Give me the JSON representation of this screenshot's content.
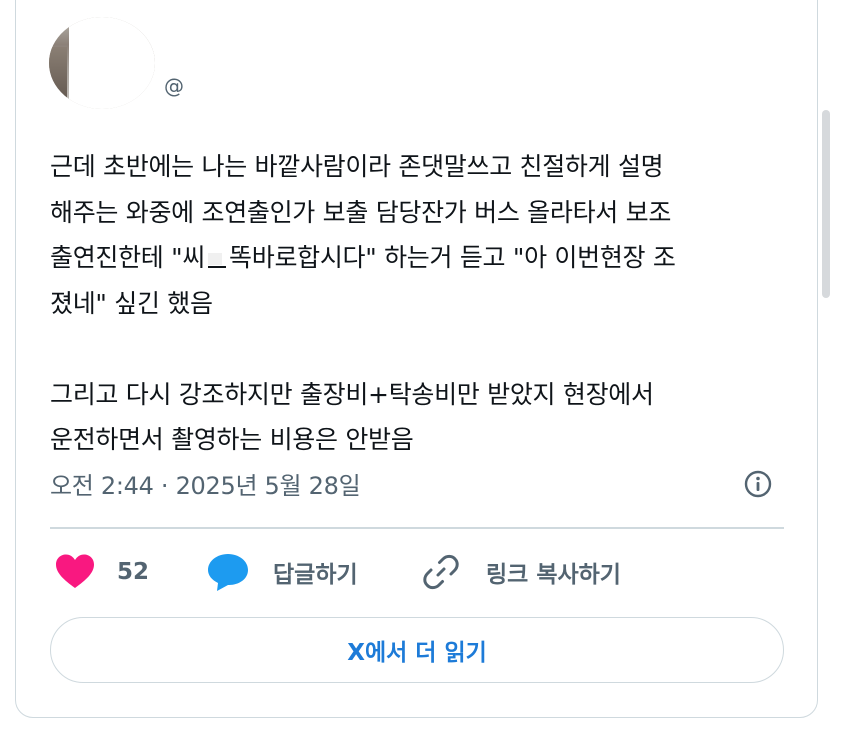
{
  "author": {
    "handle": "@"
  },
  "tweet": {
    "lines": [
      "근데 초반에는 나는 바깥사람이라 존댓말쓰고 친절하게 설명",
      "해주는 와중에 조연출인가 보출 담당잔가 버스 올라타서 보조",
      "\"아 이번현장 조",
      "졌네\" 싶긴 했음",
      "그리고 다시 강조하지만 출장비+탁송비만 받았지 현장에서",
      "운전하면서 촬영하는 비용은 안받음"
    ],
    "line3_before": "출연진한테 \"씨",
    "line3_after": "똑바로합시다\" 하는거 듣고 "
  },
  "meta": {
    "timestamp": "오전 2:44 · 2025년 5월 28일"
  },
  "actions": {
    "likes": "52",
    "reply_label": "답글하기",
    "copy_link_label": "링크 복사하기"
  },
  "read_more_label": "X에서 더 읽기",
  "colors": {
    "like": "#f91880",
    "reply": "#1d9bf0",
    "link_text": "#1d7bd8",
    "secondary_text": "#536471",
    "border": "#cfd9de"
  }
}
